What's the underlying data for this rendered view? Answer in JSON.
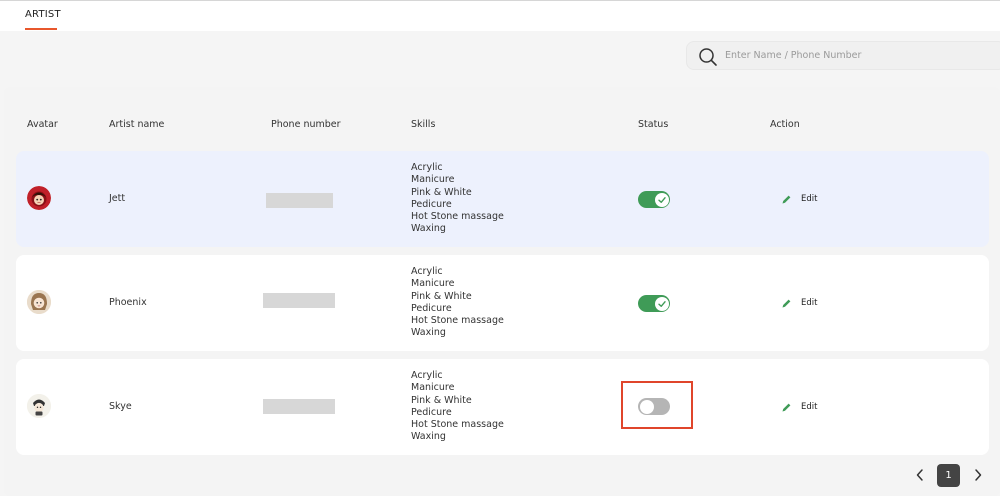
{
  "tabs": [
    {
      "label": "ARTIST",
      "active": true
    }
  ],
  "colors": {
    "accent": "#e8572c",
    "toggle_on": "#3f9b57",
    "toggle_off": "#b5b5b5",
    "selected_row": "#edf1fd"
  },
  "search": {
    "placeholder": "Enter Name / Phone Number",
    "value": ""
  },
  "table": {
    "headers": [
      "Avatar",
      "Artist name",
      "Phone number",
      "Skills",
      "Status",
      "Action"
    ],
    "rows": [
      {
        "name": "Jett",
        "skills": [
          "Acrylic",
          "Manicure",
          "Pink & White",
          "Pedicure",
          "Hot Stone massage",
          "Waxing"
        ],
        "status": true,
        "action_label": "Edit",
        "avatar_icon": "cartoon-avatar-icon",
        "selected": true
      },
      {
        "name": "Phoenix",
        "skills": [
          "Acrylic",
          "Manicure",
          "Pink & White",
          "Pedicure",
          "Hot Stone massage",
          "Waxing"
        ],
        "status": true,
        "action_label": "Edit",
        "avatar_icon": "cartoon-avatar-icon",
        "selected": false
      },
      {
        "name": "Skye",
        "skills": [
          "Acrylic",
          "Manicure",
          "Pink & White",
          "Pedicure",
          "Hot Stone massage",
          "Waxing"
        ],
        "status": false,
        "action_label": "Edit",
        "avatar_icon": "cartoon-avatar-icon",
        "selected": false
      }
    ]
  },
  "pagination": {
    "current_page": "1",
    "prev_icon": "chevron-left-icon",
    "next_icon": "chevron-right-icon"
  }
}
